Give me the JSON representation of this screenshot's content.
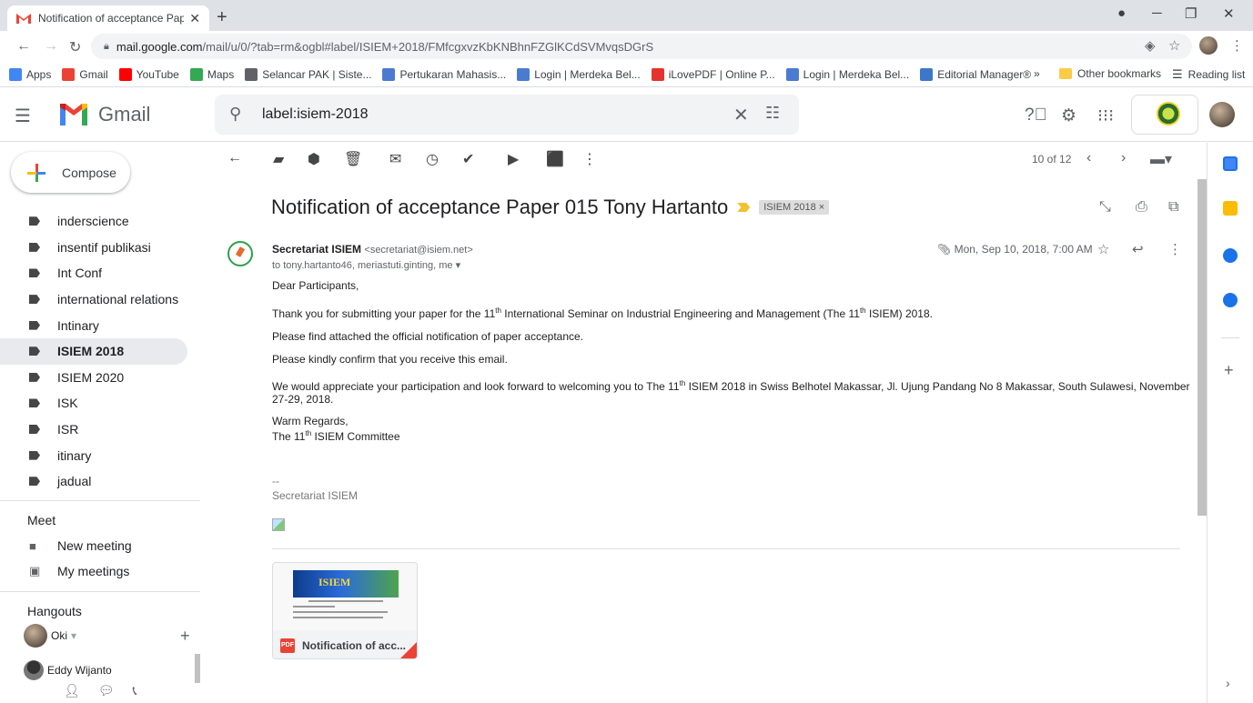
{
  "browser": {
    "tab_title": "Notification of acceptance Paper",
    "tab_close": "✕",
    "new_tab": "+",
    "url_host": "mail.google.com",
    "url_path": "/mail/u/0/?tab=rm&ogbl#label/ISIEM+2018/FMfcgxvzKbKNBhnFZGlKCdSVMvqsDGrS",
    "bookmarks": [
      {
        "label": "Apps",
        "color": "#4285f4"
      },
      {
        "label": "Gmail",
        "color": "#ea4335"
      },
      {
        "label": "YouTube",
        "color": "#ff0000"
      },
      {
        "label": "Maps",
        "color": "#34a853"
      },
      {
        "label": "Selancar PAK | Siste...",
        "color": "#5f6368"
      },
      {
        "label": "Pertukaran Mahasis...",
        "color": "#4a7bd0"
      },
      {
        "label": "Login | Merdeka Bel...",
        "color": "#4a7bd0"
      },
      {
        "label": "iLovePDF | Online P...",
        "color": "#e5322d"
      },
      {
        "label": "Login | Merdeka Bel...",
        "color": "#4a7bd0"
      },
      {
        "label": "Editorial Manager®",
        "color": "#3c78c8"
      }
    ],
    "bookmarks_more": "»",
    "other_bookmarks": "Other bookmarks",
    "reading_list": "Reading list"
  },
  "gmail": {
    "product_name": "Gmail",
    "search_value": "label:isiem-2018",
    "compose_label": "Compose",
    "labels": [
      {
        "name": "inderscience",
        "active": false
      },
      {
        "name": "insentif publikasi",
        "active": false
      },
      {
        "name": "Int Conf",
        "active": false
      },
      {
        "name": "international relations",
        "active": false
      },
      {
        "name": "Intinary",
        "active": false
      },
      {
        "name": "ISIEM 2018",
        "active": true
      },
      {
        "name": "ISIEM 2020",
        "active": false
      },
      {
        "name": "ISK",
        "active": false
      },
      {
        "name": "ISR",
        "active": false
      },
      {
        "name": "itinary",
        "active": false
      },
      {
        "name": "jadual",
        "active": false
      }
    ],
    "meet": {
      "title": "Meet",
      "new_meeting": "New meeting",
      "my_meetings": "My meetings"
    },
    "hangouts": {
      "title": "Hangouts",
      "me": "Oki",
      "contact": "Eddy Wijanto"
    },
    "pager": "10 of 12"
  },
  "message": {
    "subject": "Notification of acceptance Paper 015 Tony Hartanto",
    "label_chip": "ISIEM 2018 ×",
    "sender_name": "Secretariat ISIEM",
    "sender_email": "<secretariat@isiem.net>",
    "recipients": "to tony.hartanto46, meriastuti.ginting, me",
    "date": "Mon, Sep 10, 2018, 7:00 AM",
    "greeting": "Dear Participants,",
    "p1_a": "Thank you for submitting your paper for the 11",
    "p1_sup": "th",
    "p1_b": " International Seminar on Industrial Engineering and Management (The 11",
    "p1_sup2": "th",
    "p1_c": " ISIEM) 2018.",
    "p2": "Please find attached the official notification of paper acceptance.",
    "p3": "Please kindly confirm that you receive this email.",
    "p4_a": "We would appreciate your participation and look forward to welcoming you to The 11",
    "p4_sup": "th",
    "p4_b": " ISIEM 2018 in Swiss Belhotel Makassar, Jl. Ujung Pandang No 8 Makassar, South Sulawesi, November 27-29, 2018.",
    "closing": "Warm Regards,",
    "sig_a": "The 11",
    "sig_sup": "th",
    "sig_b": " ISIEM Committee",
    "dashes": "--",
    "signature": "Secretariat ISIEM",
    "attachment_name": "Notification of acc...",
    "attachment_type": "PDF",
    "attachment_banner": "ISIEM"
  }
}
